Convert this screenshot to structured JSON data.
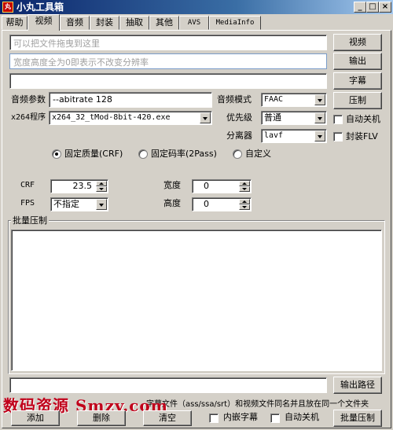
{
  "window": {
    "title": "小丸工具箱",
    "app_icon_text": "丸"
  },
  "tabs": [
    {
      "label": "帮助"
    },
    {
      "label": "视频"
    },
    {
      "label": "音频"
    },
    {
      "label": "封装"
    },
    {
      "label": "抽取"
    },
    {
      "label": "其他"
    },
    {
      "label": "AVS"
    },
    {
      "label": "MediaInfo"
    }
  ],
  "active_tab": "视频",
  "video": {
    "drop_placeholder": "可以把文件拖曳到这里",
    "size_placeholder": "宽度高度全为0即表示不改变分辨率",
    "subtitle_value": "",
    "buttons": {
      "video": "视频",
      "output": "输出",
      "subtitle": "字幕",
      "compress": "压制"
    },
    "audio_param_label": "音频参数",
    "audio_param_value": "--abitrate 128",
    "x264_label": "x264程序",
    "x264_value": "x264_32_tMod-8bit-420.exe",
    "audio_mode_label": "音频模式",
    "audio_mode_value": "FAAC",
    "priority_label": "优先级",
    "priority_value": "普通",
    "splitter_label": "分离器",
    "splitter_value": "lavf",
    "auto_shutdown_label": "自动关机",
    "flv_label": "封装FLV",
    "rate_modes": [
      {
        "label": "固定质量(CRF)",
        "selected": true
      },
      {
        "label": "固定码率(2Pass)",
        "selected": false
      },
      {
        "label": "自定义",
        "selected": false
      }
    ],
    "crf_label": "CRF",
    "crf_value": "23.5",
    "fps_label": "FPS",
    "fps_value": "不指定",
    "width_label": "宽度",
    "width_value": "0",
    "height_label": "高度",
    "height_value": "0"
  },
  "batch": {
    "legend": "批量压制",
    "output_path_value": "",
    "output_path_button": "输出路径",
    "note": "字幕文件（ass/ssa/srt）和视频文件同名并且放在同一个文件夹",
    "add_button": "添加",
    "delete_button": "删除",
    "clear_button": "清空",
    "embed_subtitle_label": "内嵌字幕",
    "auto_shutdown_label": "自动关机",
    "batch_compress_button": "批量压制"
  },
  "watermark": "数码资源  Smzy.com"
}
